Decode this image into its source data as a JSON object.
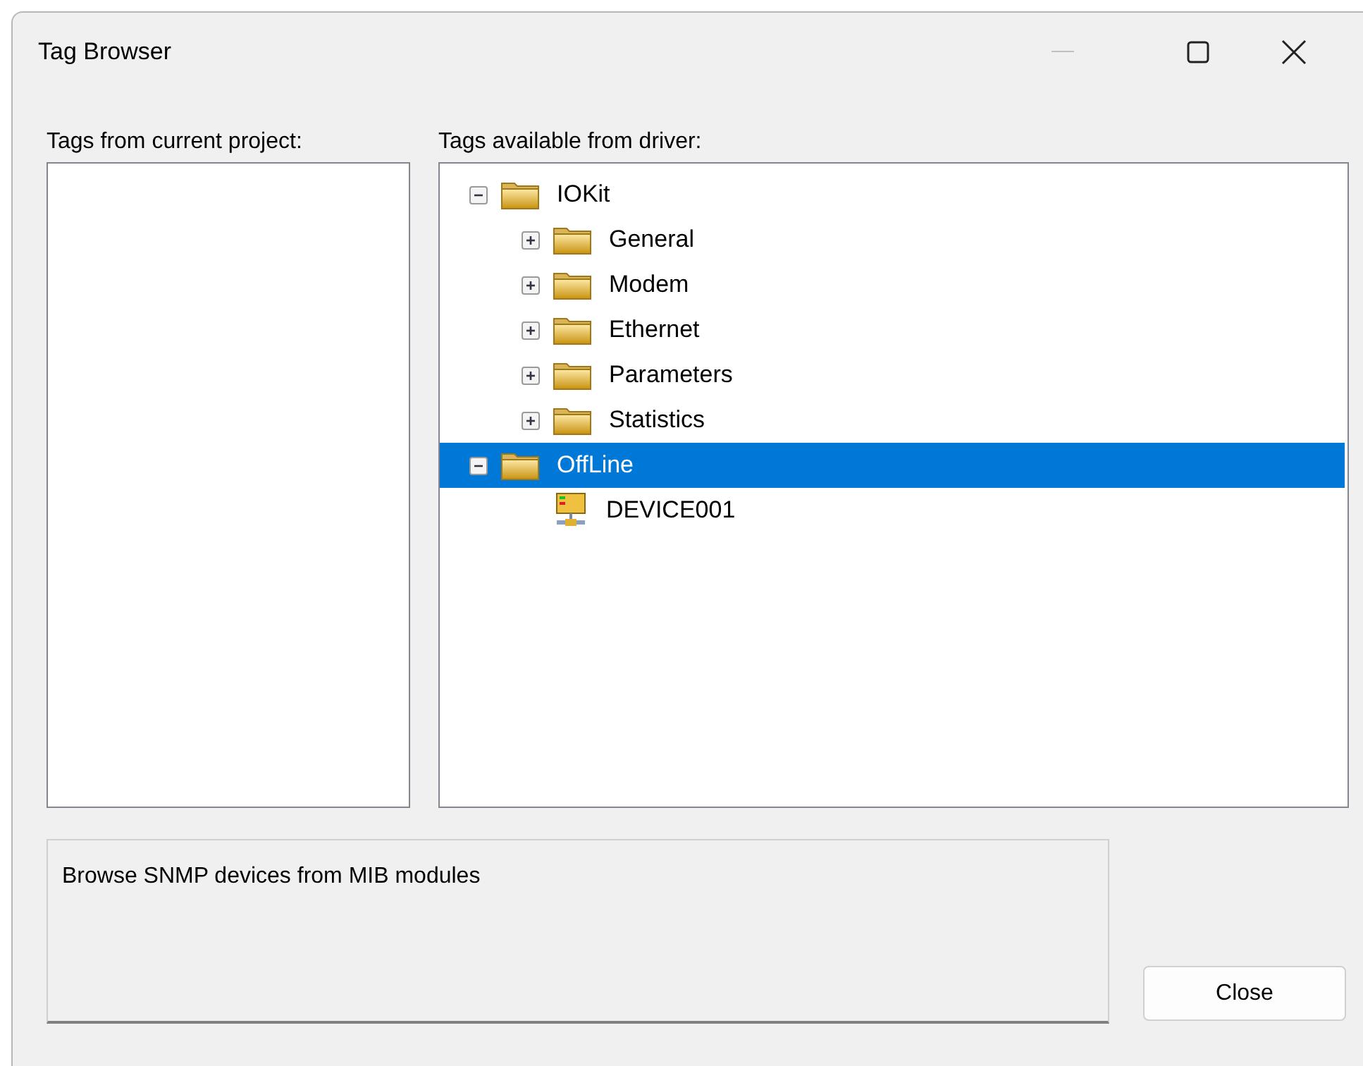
{
  "window": {
    "title": "Tag Browser"
  },
  "left_panel": {
    "label": "Tags from current project:"
  },
  "right_panel": {
    "label": "Tags available from driver:",
    "tree": [
      {
        "label": "IOKit",
        "kind": "folder",
        "expanded": true,
        "selected": false,
        "children": [
          {
            "label": "General",
            "kind": "folder",
            "expanded": false,
            "selected": false
          },
          {
            "label": "Modem",
            "kind": "folder",
            "expanded": false,
            "selected": false
          },
          {
            "label": "Ethernet",
            "kind": "folder",
            "expanded": false,
            "selected": false
          },
          {
            "label": "Parameters",
            "kind": "folder",
            "expanded": false,
            "selected": false
          },
          {
            "label": "Statistics",
            "kind": "folder",
            "expanded": false,
            "selected": false
          }
        ]
      },
      {
        "label": "OffLine",
        "kind": "folder",
        "expanded": true,
        "selected": true,
        "children": [
          {
            "label": "DEVICE001",
            "kind": "device",
            "selected": false
          }
        ]
      }
    ]
  },
  "description": "Browse SNMP devices from MIB modules",
  "buttons": [
    {
      "label": "Close"
    }
  ]
}
